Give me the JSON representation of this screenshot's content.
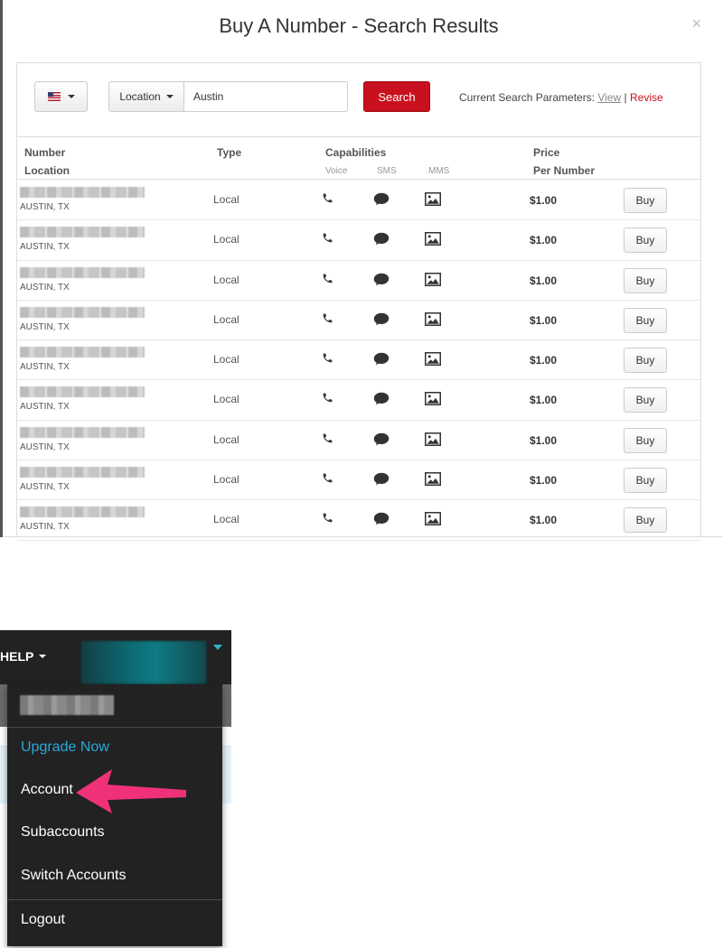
{
  "modal": {
    "title": "Buy A Number - Search Results",
    "close": "×",
    "search": {
      "country_flag": "us-flag-icon",
      "filter_label": "Location",
      "query": "Austin",
      "search_label": "Search",
      "params_label": "Current Search Parameters:",
      "view_label": "View",
      "separator": "|",
      "revise_label": "Revise"
    },
    "table": {
      "headers": {
        "number": "Number",
        "location": "Location",
        "type": "Type",
        "capabilities": "Capabilities",
        "voice": "Voice",
        "sms": "SMS",
        "mms": "MMS",
        "price": "Price",
        "per_number": "Per Number"
      },
      "rows": [
        {
          "location": "AUSTIN, TX",
          "type": "Local",
          "price": "$1.00",
          "action": "Buy"
        },
        {
          "location": "AUSTIN, TX",
          "type": "Local",
          "price": "$1.00",
          "action": "Buy"
        },
        {
          "location": "AUSTIN, TX",
          "type": "Local",
          "price": "$1.00",
          "action": "Buy"
        },
        {
          "location": "AUSTIN, TX",
          "type": "Local",
          "price": "$1.00",
          "action": "Buy"
        },
        {
          "location": "AUSTIN, TX",
          "type": "Local",
          "price": "$1.00",
          "action": "Buy"
        },
        {
          "location": "AUSTIN, TX",
          "type": "Local",
          "price": "$1.00",
          "action": "Buy"
        },
        {
          "location": "AUSTIN, TX",
          "type": "Local",
          "price": "$1.00",
          "action": "Buy"
        },
        {
          "location": "AUSTIN, TX",
          "type": "Local",
          "price": "$1.00",
          "action": "Buy"
        },
        {
          "location": "AUSTIN, TX",
          "type": "Local",
          "price": "$1.00",
          "action": "Buy"
        }
      ]
    }
  },
  "menu": {
    "help_label": "HELP",
    "items": {
      "upgrade": "Upgrade Now",
      "account": "Account",
      "subaccounts": "Subaccounts",
      "switch": "Switch Accounts",
      "logout": "Logout"
    },
    "colors": {
      "upgrade": "#29a9d8",
      "arrow": "#f0317a",
      "search_button": "#c8101e"
    }
  }
}
